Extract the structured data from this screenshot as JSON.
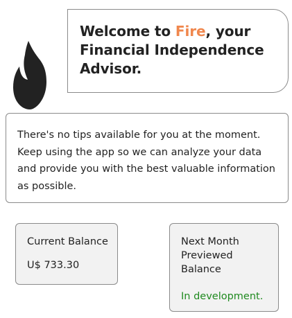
{
  "header": {
    "logo_icon": "flame-icon",
    "welcome_prefix": "Welcome to ",
    "brand_name": "Fire",
    "welcome_suffix": ", your Financial Independence Advisor.",
    "brand_color": "#f0874d"
  },
  "tips": {
    "message": "There's no tips available for you at the moment. Keep using the app so we can analyze your data and provide you with the best valuable information as possible."
  },
  "cards": {
    "current_balance": {
      "title": "Current Balance",
      "value": "U$ 733.30"
    },
    "next_month": {
      "title": "Next Month Previewed Balance",
      "value": "In development.",
      "value_color": "#1f8a1f"
    }
  }
}
